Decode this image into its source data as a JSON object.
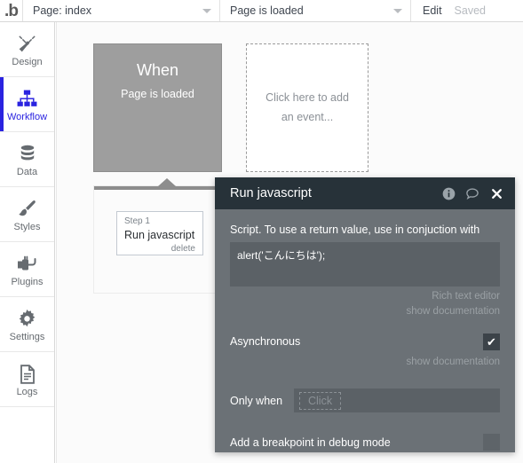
{
  "topbar": {
    "logo": "b-logo-icon",
    "page_select": "Page: index",
    "event_select": "Page is loaded",
    "edit_label": "Edit",
    "saved_label": "Saved"
  },
  "sidebar": {
    "items": [
      {
        "label": "Design",
        "icon": "design-icon",
        "active": false
      },
      {
        "label": "Workflow",
        "icon": "workflow-icon",
        "active": true
      },
      {
        "label": "Data",
        "icon": "data-icon",
        "active": false
      },
      {
        "label": "Styles",
        "icon": "styles-icon",
        "active": false
      },
      {
        "label": "Plugins",
        "icon": "plugins-icon",
        "active": false
      },
      {
        "label": "Settings",
        "icon": "settings-icon",
        "active": false
      },
      {
        "label": "Logs",
        "icon": "logs-icon",
        "active": false
      }
    ],
    "expand_handle": "expand-arrow-icon"
  },
  "canvas": {
    "when_block": {
      "title": "When",
      "subtitle": "Page is loaded"
    },
    "add_event_block": {
      "text": "Click here to add an event..."
    },
    "step_panel": {
      "step_index": "Step 1",
      "step_title": "Run javascript",
      "delete_label": "delete"
    }
  },
  "dialog": {
    "title": "Run javascript",
    "icons": {
      "info": "info-icon",
      "comment": "comment-icon",
      "close": "close-icon"
    },
    "script": {
      "label": "Script. To use a return value, use in conjuction with",
      "value": "alert('こんにちは');",
      "rich_text_hint": "Rich text editor",
      "show_documentation": "show documentation"
    },
    "asynchronous": {
      "label": "Asynchronous",
      "checked": true,
      "checkmark": "✔",
      "show_documentation": "show documentation"
    },
    "only_when": {
      "label": "Only when",
      "placeholder": "Click"
    },
    "breakpoint": {
      "label": "Add a breakpoint in debug mode",
      "checked": false
    }
  },
  "colors": {
    "accent_blue": "#2a23e0",
    "dialog_header": "#273239",
    "dialog_body": "#6b7176",
    "when_block": "#9e9e9e"
  }
}
